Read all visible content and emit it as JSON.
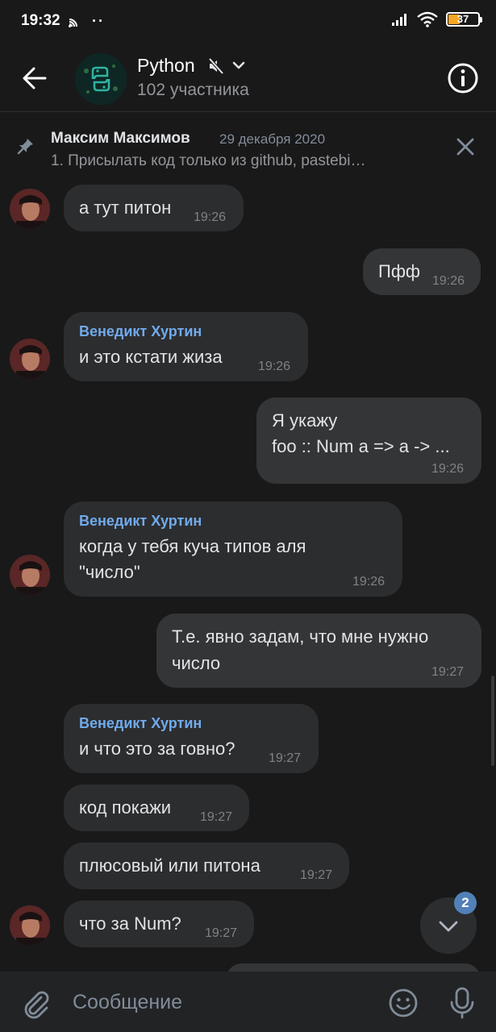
{
  "status_bar": {
    "time": "19:32",
    "battery": "37"
  },
  "header": {
    "title": "Python",
    "subtitle": "102 участника"
  },
  "pinned": {
    "author": "Максим Максимов",
    "date": "29 декабря 2020",
    "text": "1. Присылать код только из  github, pastebi…"
  },
  "messages": [
    {
      "text": "а тут питон",
      "time": "19:26"
    },
    {
      "text": "Пфф",
      "time": "19:26"
    },
    {
      "author": "Венедикт Хуртин",
      "text": "и это кстати жиза",
      "time": "19:26"
    },
    {
      "line1": "Я укажу",
      "line2": "foo :: Num a => a -> ...",
      "time": "19:26"
    },
    {
      "author": "Венедикт Хуртин",
      "line1": "когда у тебя куча типов аля",
      "line2": "\"число\"",
      "time": "19:26"
    },
    {
      "line1": "Т.е. явно задам, что мне нужно",
      "line2": "число",
      "time": "19:27"
    },
    {
      "author": "Венедикт Хуртин",
      "text": "и что это за говно?",
      "time": "19:27"
    },
    {
      "text": "код покажи",
      "time": "19:27"
    },
    {
      "text": "плюсовый или питона",
      "time": "19:27"
    },
    {
      "text": "что за Num?",
      "time": "19:27"
    }
  ],
  "scroll_button": {
    "unread": "2"
  },
  "composer": {
    "placeholder": "Сообщение"
  }
}
